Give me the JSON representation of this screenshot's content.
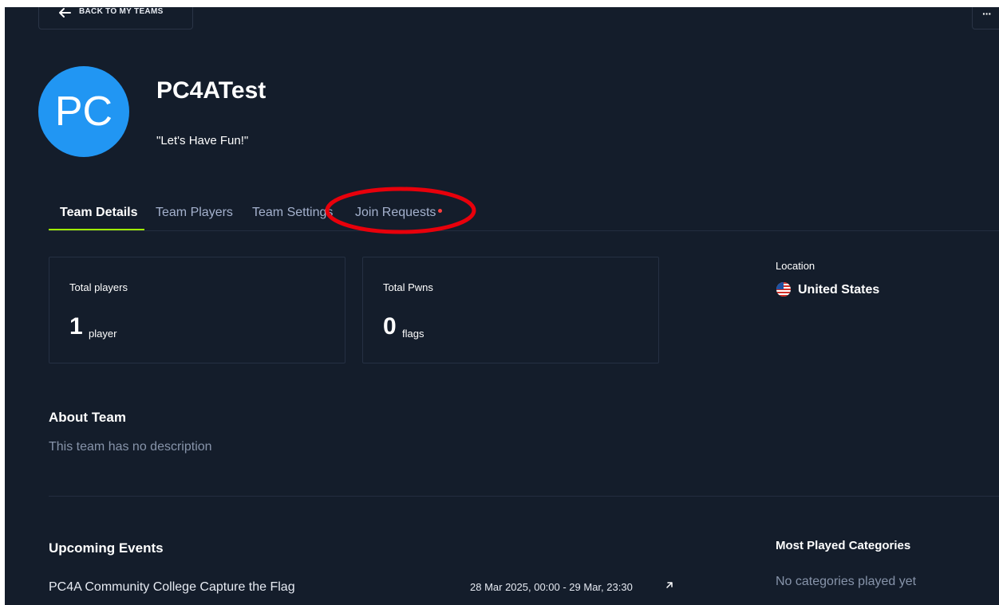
{
  "back_button": {
    "label": "BACK TO MY TEAMS",
    "icon": "arrow-left-icon"
  },
  "more_button": {
    "label": "···",
    "icon": "more-icon"
  },
  "team": {
    "avatar_initials": "PC",
    "name": "PC4ATest",
    "motto": "\"Let's Have Fun!\""
  },
  "tabs": [
    {
      "label": "Team Details",
      "active": true
    },
    {
      "label": "Team Players",
      "active": false
    },
    {
      "label": "Team Settings",
      "active": false
    },
    {
      "label": "Join Requests",
      "active": false,
      "notification": true
    }
  ],
  "stats": [
    {
      "label": "Total players",
      "value": "1",
      "unit": "player"
    },
    {
      "label": "Total Pwns",
      "value": "0",
      "unit": "flags"
    }
  ],
  "location": {
    "label": "Location",
    "value": "United States",
    "icon": "us-flag-icon"
  },
  "about": {
    "title": "About Team",
    "description": "This team has no description"
  },
  "upcoming_events": {
    "title": "Upcoming Events",
    "items": [
      {
        "name": "PC4A Community College Capture the Flag",
        "date": "28 Mar 2025, 00:00  -  29 Mar, 23:30",
        "icon": "external-link-icon"
      }
    ]
  },
  "most_played": {
    "title": "Most Played Categories",
    "empty_text": "No categories played yet"
  },
  "colors": {
    "background": "#141d2b",
    "accent": "#9fef00",
    "avatar": "#2196f3",
    "notification_dot": "#ff3e3e",
    "annotation": "#e8000b",
    "muted_text": "#8794aa"
  }
}
